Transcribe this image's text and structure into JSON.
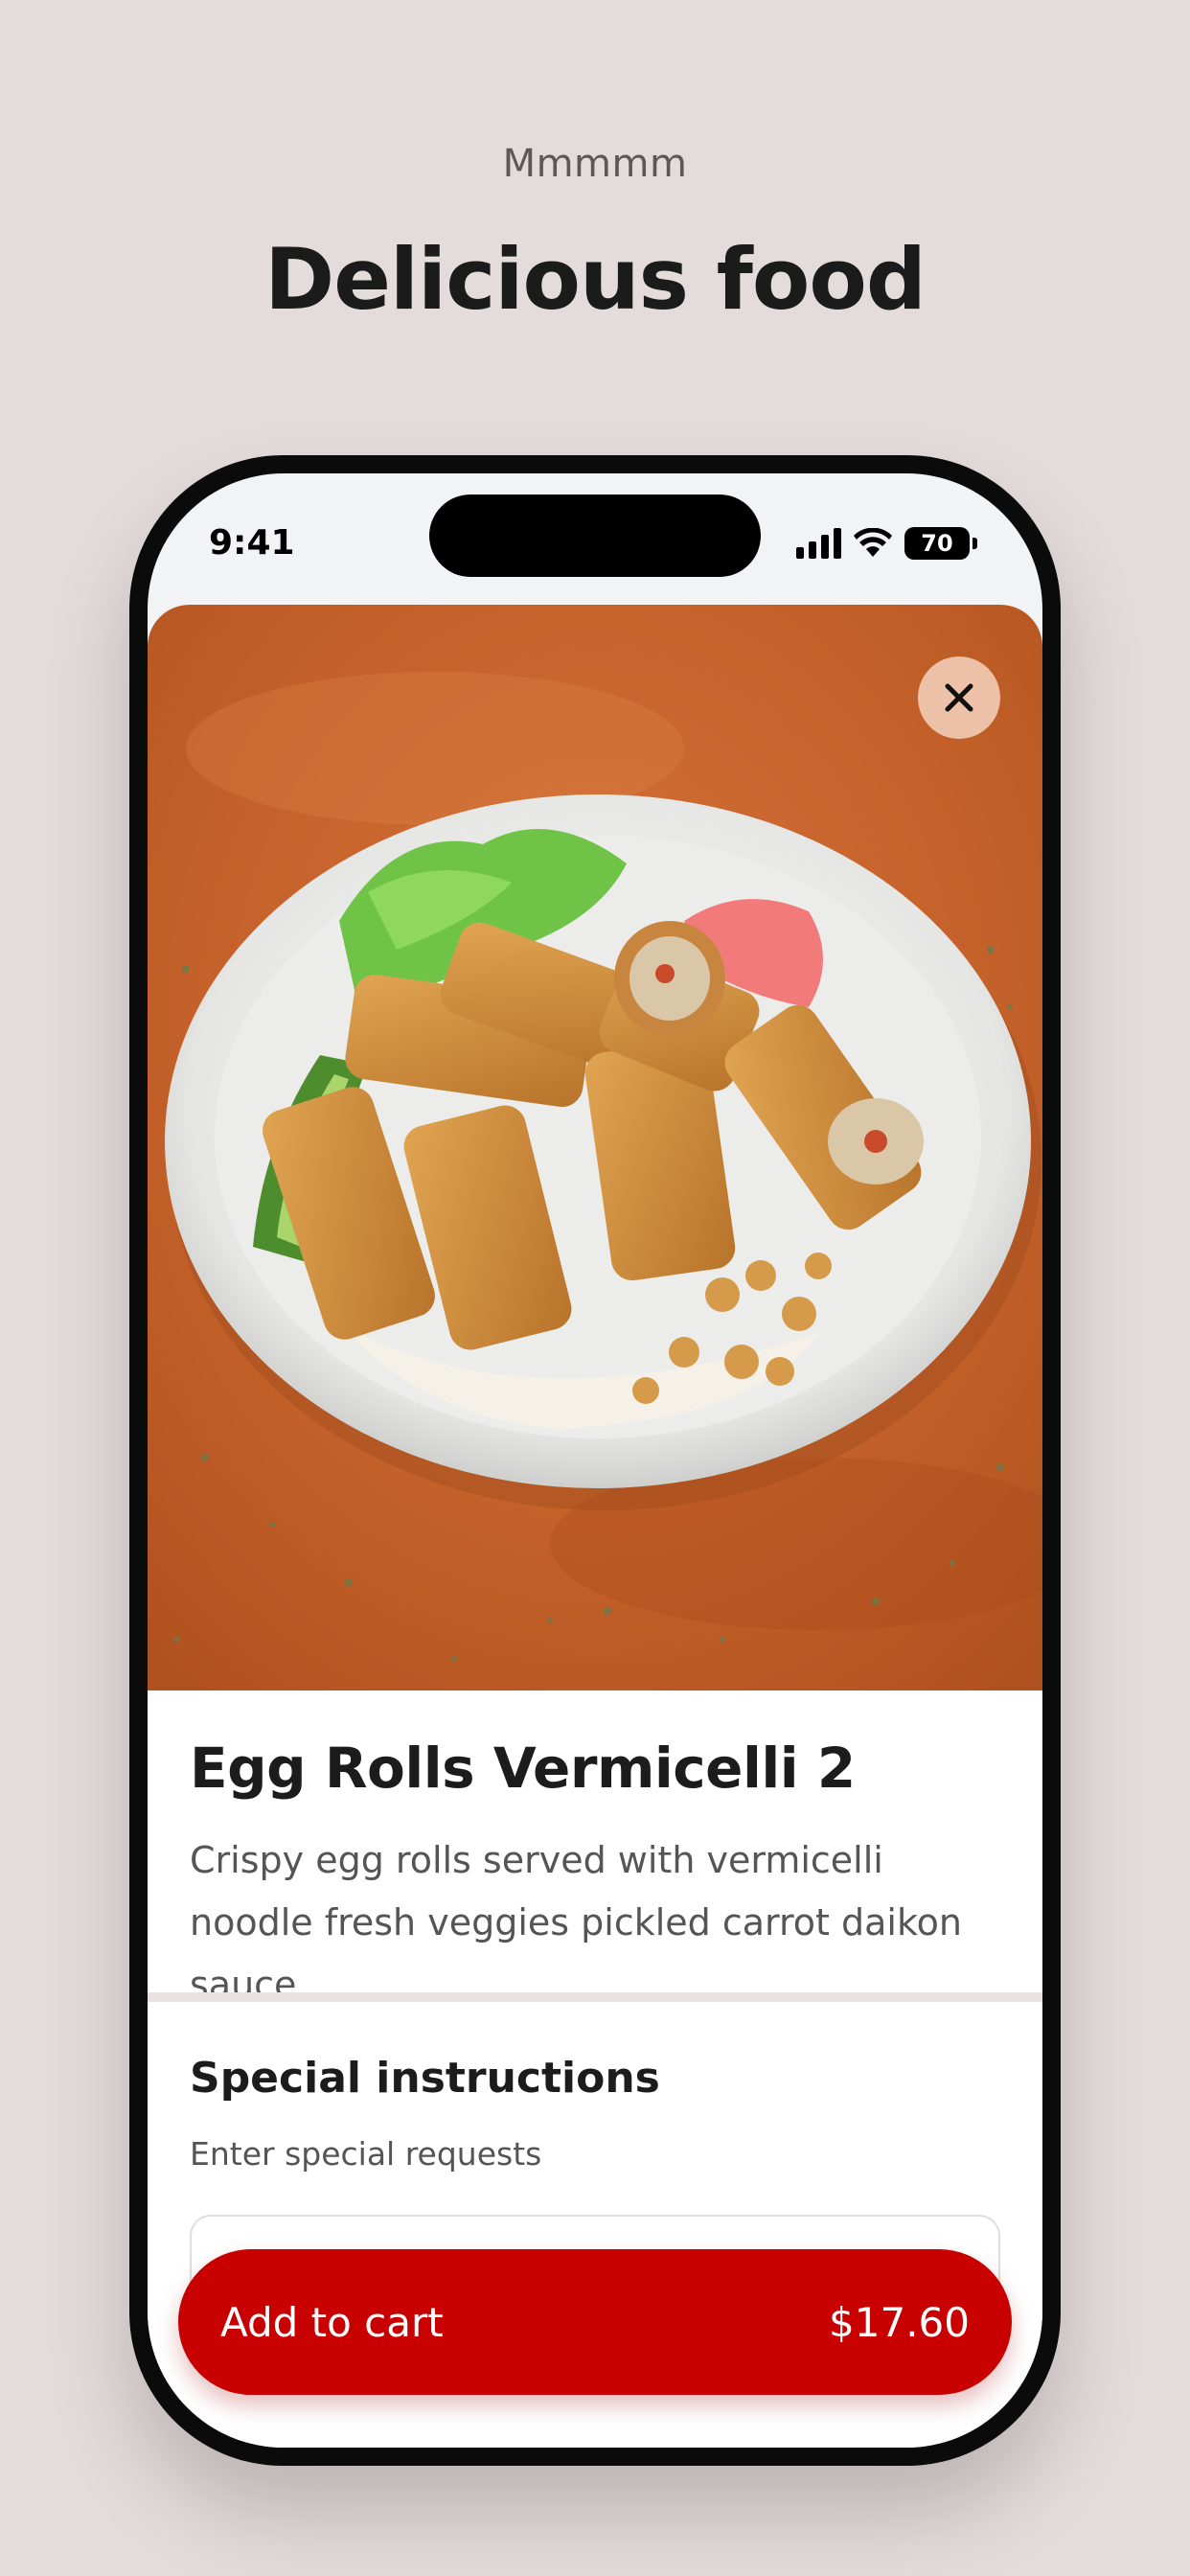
{
  "page": {
    "eyebrow": "Mmmmm",
    "headline": "Delicious food",
    "background_color": "#e4dcda"
  },
  "status_bar": {
    "time": "9:41",
    "battery": "70",
    "icons": [
      "signal-icon",
      "wifi-icon",
      "battery-icon"
    ]
  },
  "item": {
    "title": "Egg Rolls Vermicelli 2",
    "description": "Crispy egg rolls served with vermicelli noodle fresh veggies pickled carrot daikon sauce",
    "image": "egg-rolls-vermicelli-bowl-photo",
    "close_icon": "close-icon"
  },
  "special_instructions": {
    "title": "Special instructions",
    "subtitle": "Enter special requests",
    "value": ""
  },
  "cart_button": {
    "label": "Add to cart",
    "price": "$17.60",
    "color": "#c80000"
  }
}
